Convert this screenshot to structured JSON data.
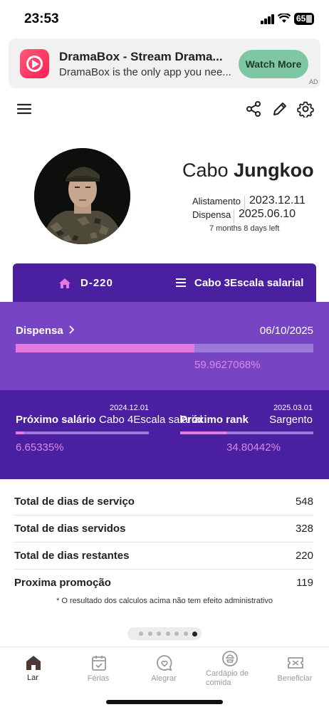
{
  "status_bar": {
    "time": "23:53",
    "battery": "65"
  },
  "ad": {
    "title": "DramaBox - Stream Drama...",
    "subtitle": "DramaBox is the only app you nee...",
    "button": "Watch More",
    "tag": "AD"
  },
  "toolbar": {
    "menu_icon": "menu-icon",
    "share_icon": "share-icon",
    "edit_icon": "pencil-icon",
    "settings_icon": "gear-icon"
  },
  "profile": {
    "rank": "Cabo",
    "name": "Jungkoo",
    "enlistment_label": "Alistamento",
    "enlistment_date": "2023.12.11",
    "discharge_label": "Dispensa",
    "discharge_date": "2025.06.10",
    "remaining_text": "7 months 8 days left"
  },
  "rank_bar": {
    "dday": "D-220",
    "salary_rank": "Cabo 3Escala salarial"
  },
  "discharge_panel": {
    "label": "Dispensa",
    "date": "06/10/2025",
    "percent_text": "59.9627068%",
    "percent_value": 59.9627068
  },
  "next_salary": {
    "label": "Próximo salário",
    "date": "2024.12.01",
    "value": "Cabo 4Escala salarial",
    "percent_text": "6.65335%",
    "percent_value": 6.65335
  },
  "next_rank": {
    "label": "Próximo rank",
    "date": "2025.03.01",
    "value": "Sargento",
    "percent_text": "34.80442%",
    "percent_value": 34.80442
  },
  "stats": [
    {
      "label": "Total de dias de serviço",
      "value": "548"
    },
    {
      "label": "Total de dias servidos",
      "value": "328"
    },
    {
      "label": "Total de dias restantes",
      "value": "220"
    },
    {
      "label": "Proxima promoção",
      "value": "119"
    }
  ],
  "disclaimer": "* O resultado dos calculos acima não tem efeito administrativo",
  "pager": {
    "pages": 7,
    "active": 7
  },
  "nav": [
    {
      "label": "Lar",
      "icon": "home-icon",
      "active": true
    },
    {
      "label": "Férias",
      "icon": "calendar-check-icon",
      "active": false
    },
    {
      "label": "Alegrar",
      "icon": "heart-chat-icon",
      "active": false
    },
    {
      "label": "Cardápio de comida",
      "icon": "rice-bowl-icon",
      "active": false
    },
    {
      "label": "Beneficiar",
      "icon": "ticket-icon",
      "active": false
    }
  ],
  "colors": {
    "primary": "#4a1fa0",
    "panel": "#7744c4",
    "progress": "#e879e0",
    "ad_button": "#7fc6a4"
  }
}
